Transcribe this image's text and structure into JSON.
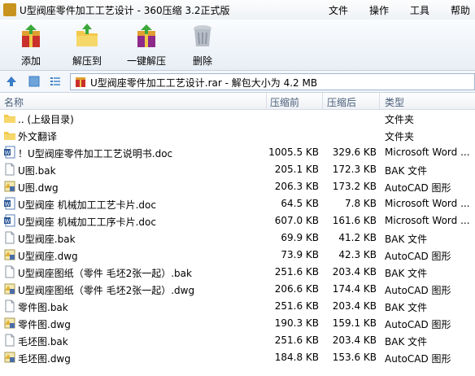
{
  "window": {
    "title": "U型阀座零件加工工艺设计 - 360压缩 3.2正式版",
    "menus": [
      "文件",
      "操作",
      "工具",
      "帮助"
    ]
  },
  "toolbar": {
    "buttons": [
      {
        "label": "添加",
        "icon": "add-archive-icon"
      },
      {
        "label": "解压到",
        "icon": "extract-to-folder-icon"
      },
      {
        "label": "一键解压",
        "icon": "one-click-extract-icon"
      },
      {
        "label": "删除",
        "icon": "trash-icon"
      }
    ]
  },
  "pathbar": {
    "path": "U型阀座零件加工工艺设计.rar - 解包大小为 4.2 MB"
  },
  "columns": {
    "name": "名称",
    "size": "压缩前",
    "compressed": "压缩后",
    "type": "类型"
  },
  "files": [
    {
      "name": ".. (上级目录)",
      "size": "",
      "compressed": "",
      "type": "文件夹",
      "icon": "folder-icon"
    },
    {
      "name": "外文翻译",
      "size": "",
      "compressed": "",
      "type": "文件夹",
      "icon": "folder-icon"
    },
    {
      "name": "！U型阀座零件加工工艺说明书.doc",
      "size": "1005.5 KB",
      "compressed": "329.6 KB",
      "type": "Microsoft Word ...",
      "icon": "word-doc-icon"
    },
    {
      "name": "U图.bak",
      "size": "205.1 KB",
      "compressed": "172.3 KB",
      "type": "BAK 文件",
      "icon": "blank-file-icon"
    },
    {
      "name": "U图.dwg",
      "size": "206.3 KB",
      "compressed": "173.2 KB",
      "type": "AutoCAD 图形",
      "icon": "autocad-icon"
    },
    {
      "name": "U型阀座 机械加工工艺卡片.doc",
      "size": "64.5 KB",
      "compressed": "7.8 KB",
      "type": "Microsoft Word ...",
      "icon": "word-doc-icon"
    },
    {
      "name": "U型阀座 机械加工工序卡片.doc",
      "size": "607.0 KB",
      "compressed": "161.6 KB",
      "type": "Microsoft Word ...",
      "icon": "word-doc-icon"
    },
    {
      "name": "U型阀座.bak",
      "size": "69.9 KB",
      "compressed": "41.2 KB",
      "type": "BAK 文件",
      "icon": "blank-file-icon"
    },
    {
      "name": "U型阀座.dwg",
      "size": "73.9 KB",
      "compressed": "42.3 KB",
      "type": "AutoCAD 图形",
      "icon": "autocad-icon"
    },
    {
      "name": "U型阀座图纸（零件 毛坯2张一起）.bak",
      "size": "251.6 KB",
      "compressed": "203.4 KB",
      "type": "BAK 文件",
      "icon": "blank-file-icon"
    },
    {
      "name": "U型阀座图纸（零件 毛坯2张一起）.dwg",
      "size": "206.6 KB",
      "compressed": "174.4 KB",
      "type": "AutoCAD 图形",
      "icon": "autocad-icon"
    },
    {
      "name": "零件图.bak",
      "size": "251.6 KB",
      "compressed": "203.4 KB",
      "type": "BAK 文件",
      "icon": "blank-file-icon"
    },
    {
      "name": "零件图.dwg",
      "size": "190.3 KB",
      "compressed": "159.1 KB",
      "type": "AutoCAD 图形",
      "icon": "autocad-icon"
    },
    {
      "name": "毛坯图.bak",
      "size": "251.6 KB",
      "compressed": "203.4 KB",
      "type": "BAK 文件",
      "icon": "blank-file-icon"
    },
    {
      "name": "毛坯图.dwg",
      "size": "184.8 KB",
      "compressed": "153.6 KB",
      "type": "AutoCAD 图形",
      "icon": "autocad-icon"
    }
  ]
}
